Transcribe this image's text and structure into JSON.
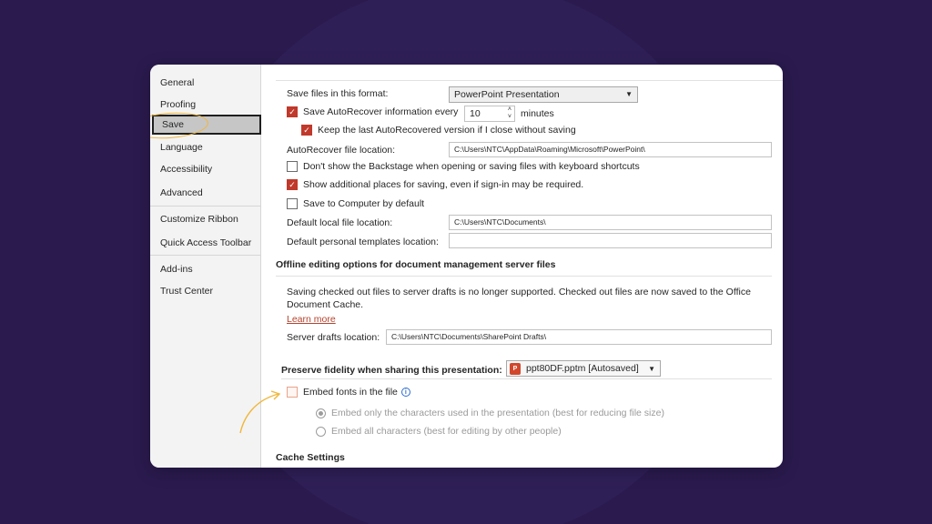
{
  "sidebar": {
    "items": [
      {
        "label": "General"
      },
      {
        "label": "Proofing"
      },
      {
        "label": "Save"
      },
      {
        "label": "Language"
      },
      {
        "label": "Accessibility"
      },
      {
        "label": "Advanced"
      },
      {
        "label": "Customize Ribbon"
      },
      {
        "label": "Quick Access Toolbar"
      },
      {
        "label": "Add-ins"
      },
      {
        "label": "Trust Center"
      }
    ],
    "selected": "Save"
  },
  "save": {
    "format_label": "Save files in this format:",
    "format_value": "PowerPoint Presentation",
    "autorecover_label": "Save AutoRecover information every",
    "autorecover_value": "10",
    "minutes_label": "minutes",
    "keep_last_label": "Keep the last AutoRecovered version if I close without saving",
    "autorecover_location_label": "AutoRecover file location:",
    "autorecover_location_value": "C:\\Users\\NTC\\AppData\\Roaming\\Microsoft\\PowerPoint\\",
    "dont_show_backstage_label": "Don't show the Backstage when opening or saving files with keyboard shortcuts",
    "show_additional_places_label": "Show additional places for saving, even if sign-in may be required.",
    "save_to_computer_label": "Save to Computer by default",
    "default_local_label": "Default local file location:",
    "default_local_value": "C:\\Users\\NTC\\Documents\\",
    "default_templates_label": "Default personal templates location:",
    "default_templates_value": ""
  },
  "offline": {
    "title": "Offline editing options for document management server files",
    "note_line1": "Saving checked out files to server drafts is no longer supported. Checked out files are now saved to the Office",
    "note_line2": "Document Cache.",
    "learn_more": "Learn more",
    "server_drafts_label": "Server drafts location:",
    "server_drafts_value": "C:\\Users\\NTC\\Documents\\SharePoint Drafts\\"
  },
  "fidelity": {
    "title": "Preserve fidelity when sharing this presentation:",
    "file_value": "ppt80DF.pptm [Autosaved]",
    "embed_fonts_label": "Embed fonts in the file",
    "embed_only_label": "Embed only the characters used in the presentation (best for reducing file size)",
    "embed_all_label": "Embed all characters (best for editing by other people)"
  },
  "cache": {
    "title": "Cache Settings"
  },
  "colors": {
    "background": "#2a1a4e",
    "accent_red": "#c0392b",
    "highlight": "#f0b63a",
    "link": "#b4432e"
  }
}
